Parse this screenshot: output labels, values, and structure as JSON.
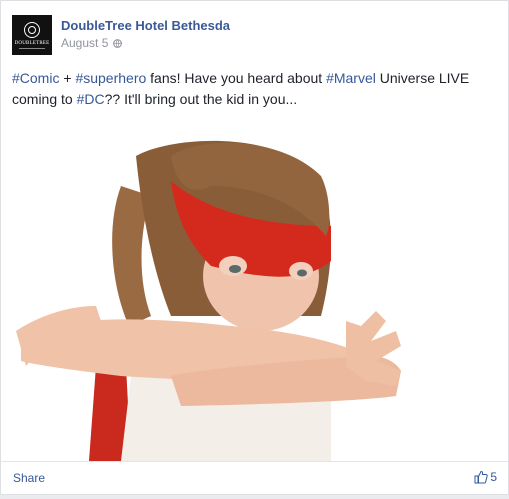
{
  "post": {
    "page_name": "DoubleTree Hotel Bethesda",
    "date": "August 5",
    "privacy_icon": "globe-icon",
    "avatar_text": "DOUBLETREE",
    "text_parts": [
      {
        "text": "#Comic",
        "tag": true
      },
      {
        "text": " + ",
        "tag": false
      },
      {
        "text": "#superhero",
        "tag": true
      },
      {
        "text": " fans! Have you heard about ",
        "tag": false
      },
      {
        "text": "#Marvel",
        "tag": true
      },
      {
        "text": " Universe LIVE coming to ",
        "tag": false
      },
      {
        "text": "#DC",
        "tag": true
      },
      {
        "text": "?? It'll bring out the kid in you...",
        "tag": false
      }
    ],
    "image_icon": "photo-child-superhero-mask",
    "share_label": "Share",
    "like_icon": "thumbs-up-icon",
    "like_count": "5"
  },
  "colors": {
    "link": "#365899",
    "name": "#3b5998",
    "mask_red": "#d42a1e"
  }
}
